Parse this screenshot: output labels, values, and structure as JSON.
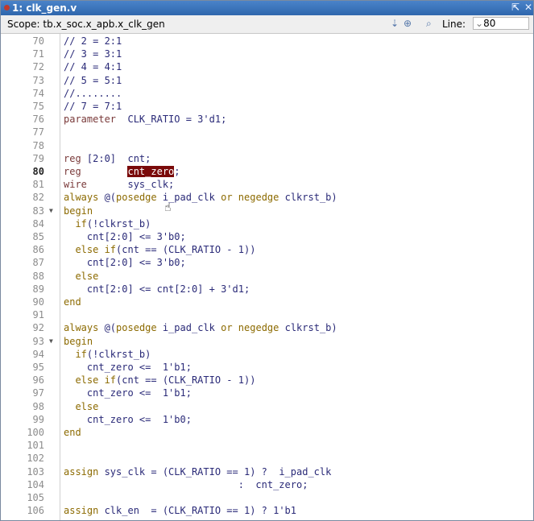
{
  "window": {
    "title": "1: clk_gen.v",
    "restore_icon": "restore-icon",
    "close_icon": "close-icon"
  },
  "toolbar": {
    "scope_text": "Scope: tb.x_soc.x_apb.x_clk_gen",
    "line_label": "Line:",
    "line_value": "80",
    "line_prefix": "⌄"
  },
  "editor": {
    "lines": [
      {
        "n": "70",
        "segs": [
          {
            "t": "// 2 = 2:1"
          }
        ]
      },
      {
        "n": "71",
        "segs": [
          {
            "t": "// 3 = 3:1"
          }
        ]
      },
      {
        "n": "72",
        "segs": [
          {
            "t": "// 4 = 4:1"
          }
        ]
      },
      {
        "n": "73",
        "segs": [
          {
            "t": "// 5 = 5:1"
          }
        ]
      },
      {
        "n": "74",
        "segs": [
          {
            "t": "//........"
          }
        ]
      },
      {
        "n": "75",
        "segs": [
          {
            "t": "// 7 = 7:1"
          }
        ]
      },
      {
        "n": "76",
        "segs": [
          {
            "t": "parameter",
            "c": "kw"
          },
          {
            "t": "  CLK_RATIO = 3'd1;"
          }
        ]
      },
      {
        "n": "77",
        "segs": []
      },
      {
        "n": "78",
        "segs": []
      },
      {
        "n": "79",
        "segs": [
          {
            "t": "reg",
            "c": "kw"
          },
          {
            "t": " [2:0]  cnt;"
          }
        ]
      },
      {
        "n": "80",
        "current": true,
        "segs": [
          {
            "t": "reg",
            "c": "kw"
          },
          {
            "t": "        "
          },
          {
            "t": "cnt_zero",
            "c": "hl"
          },
          {
            "t": ";"
          }
        ]
      },
      {
        "n": "81",
        "segs": [
          {
            "t": "wire",
            "c": "kw"
          },
          {
            "t": "       sys_clk;"
          }
        ]
      },
      {
        "n": "82",
        "segs": [
          {
            "t": "always",
            "c": "kw2"
          },
          {
            "t": " @("
          },
          {
            "t": "posedge",
            "c": "kw2"
          },
          {
            "t": " i_pad_clk "
          },
          {
            "t": "or",
            "c": "kw2"
          },
          {
            "t": " "
          },
          {
            "t": "negedge",
            "c": "kw2"
          },
          {
            "t": " clkrst_b)"
          }
        ]
      },
      {
        "n": "83",
        "fold": true,
        "segs": [
          {
            "t": "begin",
            "c": "kw2"
          }
        ]
      },
      {
        "n": "84",
        "segs": [
          {
            "t": "  "
          },
          {
            "t": "if",
            "c": "kw2"
          },
          {
            "t": "(!clkrst_b)"
          }
        ]
      },
      {
        "n": "85",
        "segs": [
          {
            "t": "    cnt[2:0] <= 3'b0;"
          }
        ]
      },
      {
        "n": "86",
        "segs": [
          {
            "t": "  "
          },
          {
            "t": "else if",
            "c": "kw2"
          },
          {
            "t": "(cnt == (CLK_RATIO - 1))"
          }
        ]
      },
      {
        "n": "87",
        "segs": [
          {
            "t": "    cnt[2:0] <= 3'b0;"
          }
        ]
      },
      {
        "n": "88",
        "segs": [
          {
            "t": "  "
          },
          {
            "t": "else",
            "c": "kw2"
          }
        ]
      },
      {
        "n": "89",
        "segs": [
          {
            "t": "    cnt[2:0] <= cnt[2:0] + 3'd1;"
          }
        ]
      },
      {
        "n": "90",
        "segs": [
          {
            "t": "end",
            "c": "kw2"
          }
        ]
      },
      {
        "n": "91",
        "segs": []
      },
      {
        "n": "92",
        "segs": [
          {
            "t": "always",
            "c": "kw2"
          },
          {
            "t": " @("
          },
          {
            "t": "posedge",
            "c": "kw2"
          },
          {
            "t": " i_pad_clk "
          },
          {
            "t": "or",
            "c": "kw2"
          },
          {
            "t": " "
          },
          {
            "t": "negedge",
            "c": "kw2"
          },
          {
            "t": " clkrst_b)"
          }
        ]
      },
      {
        "n": "93",
        "fold": true,
        "segs": [
          {
            "t": "begin",
            "c": "kw2"
          }
        ]
      },
      {
        "n": "94",
        "segs": [
          {
            "t": "  "
          },
          {
            "t": "if",
            "c": "kw2"
          },
          {
            "t": "(!clkrst_b)"
          }
        ]
      },
      {
        "n": "95",
        "segs": [
          {
            "t": "    cnt_zero <=  1'b1;"
          }
        ]
      },
      {
        "n": "96",
        "segs": [
          {
            "t": "  "
          },
          {
            "t": "else if",
            "c": "kw2"
          },
          {
            "t": "(cnt == (CLK_RATIO - 1))"
          }
        ]
      },
      {
        "n": "97",
        "segs": [
          {
            "t": "    cnt_zero <=  1'b1;"
          }
        ]
      },
      {
        "n": "98",
        "segs": [
          {
            "t": "  "
          },
          {
            "t": "else",
            "c": "kw2"
          }
        ]
      },
      {
        "n": "99",
        "segs": [
          {
            "t": "    cnt_zero <=  1'b0;"
          }
        ]
      },
      {
        "n": "100",
        "segs": [
          {
            "t": "end",
            "c": "kw2"
          }
        ]
      },
      {
        "n": "101",
        "segs": []
      },
      {
        "n": "102",
        "segs": []
      },
      {
        "n": "103",
        "segs": [
          {
            "t": "assign",
            "c": "kw2"
          },
          {
            "t": " sys_clk = (CLK_RATIO == 1) ?  i_pad_clk"
          }
        ]
      },
      {
        "n": "104",
        "segs": [
          {
            "t": "                              :  cnt_zero;"
          }
        ]
      },
      {
        "n": "105",
        "segs": []
      },
      {
        "n": "106",
        "segs": [
          {
            "t": "assign",
            "c": "kw2"
          },
          {
            "t": " clk_en  = (CLK_RATIO == 1) ? 1'b1"
          }
        ]
      }
    ]
  },
  "colors": {
    "keyword": "#7a3a3a",
    "keyword_flow": "#8c6a00",
    "identifier": "#2a2a78",
    "highlight_bg": "#7a0a0a"
  }
}
